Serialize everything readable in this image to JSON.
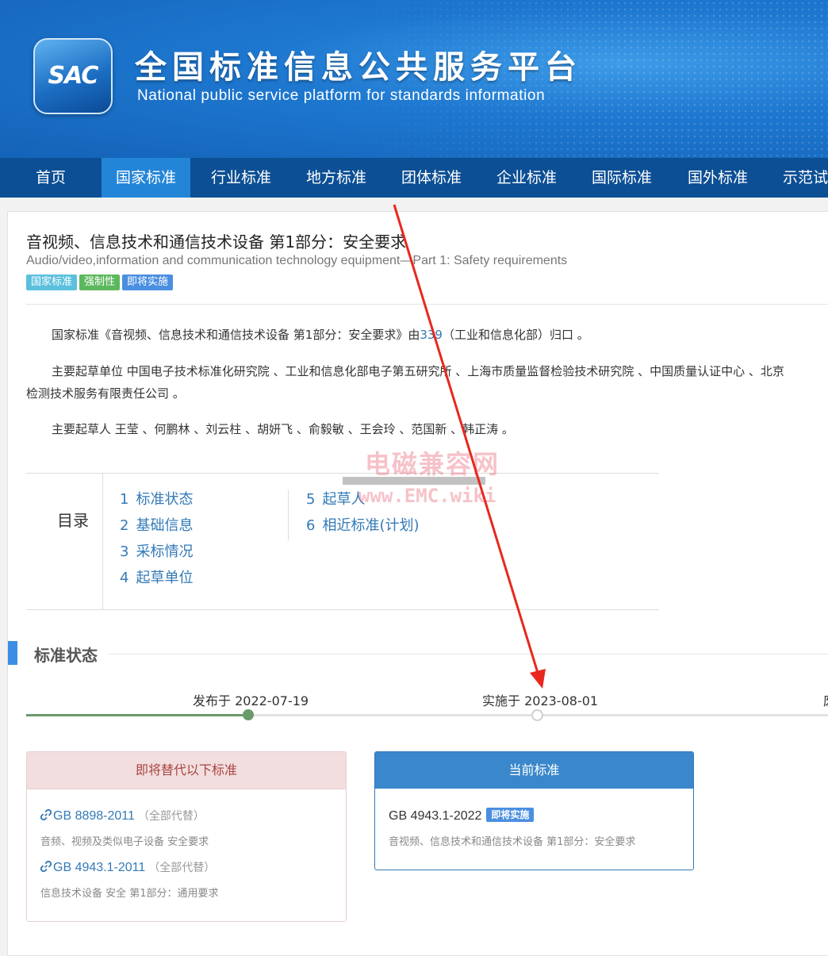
{
  "header": {
    "logo_text": "SAC",
    "title_cn": "全国标准信息公共服务平台",
    "title_en": "National public service platform  for standards information"
  },
  "nav": {
    "items": [
      "首页",
      "国家标准",
      "行业标准",
      "地方标准",
      "团体标准",
      "企业标准",
      "国际标准",
      "国外标准",
      "示范试"
    ],
    "active": "国家标准"
  },
  "standard": {
    "title": "音视频、信息技术和通信技术设备 第1部分：安全要求",
    "title_en": "Audio/video,information and communication technology equipment—Part 1: Safety requirements",
    "tags": [
      "国家标准",
      "强制性",
      "即将实施"
    ]
  },
  "intro": {
    "p1_prefix": "国家标准《音视频、信息技术和通信技术设备 第1部分：安全要求》由",
    "p1_link": "339",
    "p1_suffix": "（工业和信息化部）归口 。",
    "p2_line1": "主要起草单位 中国电子技术标准化研究院 、工业和信息化部电子第五研究所 、上海市质量监督检验技术研究院 、中国质量认证中心 、北京",
    "p2_line2": "检测技术服务有限责任公司 。",
    "p3": "主要起草人 王莹 、何鹏林 、刘云柱 、胡妍飞 、俞毅敏 、王会玲 、范国新 、韩正涛 。"
  },
  "toc": {
    "label": "目录",
    "col1": [
      {
        "num": "1",
        "text": "标准状态"
      },
      {
        "num": "2",
        "text": "基础信息"
      },
      {
        "num": "3",
        "text": "采标情况"
      },
      {
        "num": "4",
        "text": "起草单位"
      }
    ],
    "col2": [
      {
        "num": "5",
        "text": "起草人"
      },
      {
        "num": "6",
        "text": "相近标准(计划)"
      }
    ]
  },
  "status_section": {
    "heading": "标准状态",
    "published": "发布于 2022-07-19",
    "implemented": "实施于 2023-08-01",
    "third_partial": "废",
    "progress_reached": "发布于"
  },
  "replaces": {
    "heading": "即将替代以下标准",
    "items": [
      {
        "code": "GB 8898-2011",
        "note": "（全部代替）",
        "desc": "音频、视频及类似电子设备 安全要求"
      },
      {
        "code": "GB 4943.1-2011",
        "note": "（全部代替）",
        "desc": "信息技术设备 安全 第1部分：通用要求"
      }
    ]
  },
  "current": {
    "heading": "当前标准",
    "code": "GB 4943.1-2022",
    "badge": "即将实施",
    "desc": "音视频、信息技术和通信技术设备 第1部分：安全要求"
  },
  "watermark": {
    "line1": "电磁兼容网",
    "line2": "www.EMC.wiki"
  },
  "colors": {
    "nav_bg": "#0c4f94",
    "nav_active": "#2385d8",
    "link": "#337ab7",
    "annotation_arrow": "#e8281e"
  }
}
